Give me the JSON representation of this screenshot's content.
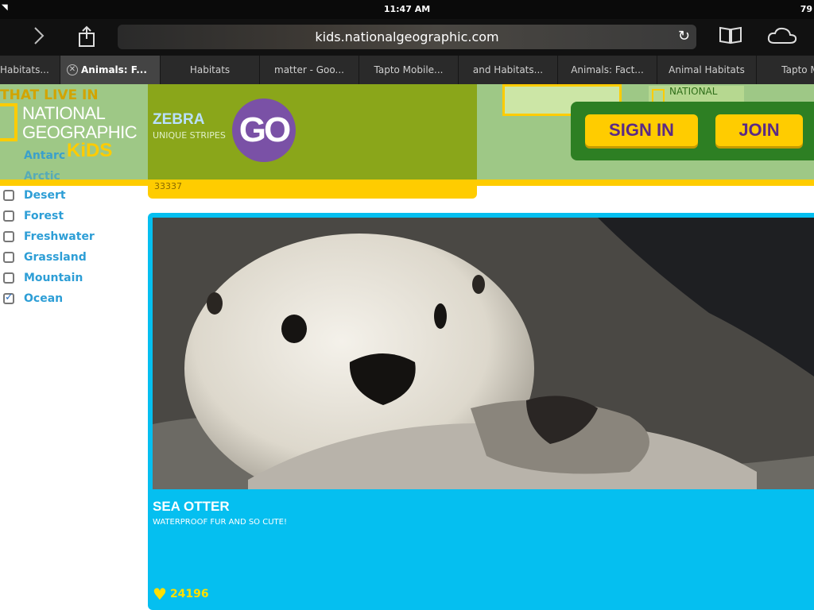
{
  "status_bar": {
    "time": "11:47 AM",
    "battery": "79"
  },
  "toolbar": {
    "url": "kids.nationalgeographic.com",
    "icons": [
      "forward-icon",
      "share-icon",
      "reload-icon",
      "bookmarks-icon",
      "icloud-tabs-icon"
    ]
  },
  "tabs": [
    {
      "label": "Habitats..."
    },
    {
      "label": "Animals: F...",
      "active": true
    },
    {
      "label": "Habitats"
    },
    {
      "label": "matter - Goo..."
    },
    {
      "label": "Tapto Mobile..."
    },
    {
      "label": "and Habitats..."
    },
    {
      "label": "Animals: Fact..."
    },
    {
      "label": "Animal Habitats"
    },
    {
      "label": "Tapto Mob"
    }
  ],
  "header": {
    "that_live_in": "THAT LIVE IN",
    "logo_line1": "NATIONAL",
    "logo_line2": "GEOGRAPHIC",
    "logo_kids": "KiDS",
    "hidden_cats": [
      "Antarc",
      "Arctic"
    ],
    "zebra_title": "ZEBRA",
    "zebra_sub": "UNIQUE STRIPES",
    "go_label": "GO",
    "yellow_strip_text": "33337",
    "natgeo_mini": "NATIONAL",
    "sign_in": "SIGN IN",
    "join": "JOIN"
  },
  "sidebar": {
    "categories": [
      {
        "label": "Desert",
        "checked": false
      },
      {
        "label": "Forest",
        "checked": false
      },
      {
        "label": "Freshwater",
        "checked": false
      },
      {
        "label": "Grassland",
        "checked": false
      },
      {
        "label": "Mountain",
        "checked": false
      },
      {
        "label": "Ocean",
        "checked": true
      }
    ]
  },
  "card": {
    "title": "SEA OTTER",
    "subtitle": "WATERPROOF FUR AND SO CUTE!",
    "likes": "24196"
  },
  "colors": {
    "header_green": "#9ec886",
    "zebra_green": "#8aa61a",
    "natgeo_yellow": "#ffcc00",
    "card_blue": "#05bff0",
    "go_purple": "#7a51a6",
    "auth_green": "#2d7f23"
  }
}
